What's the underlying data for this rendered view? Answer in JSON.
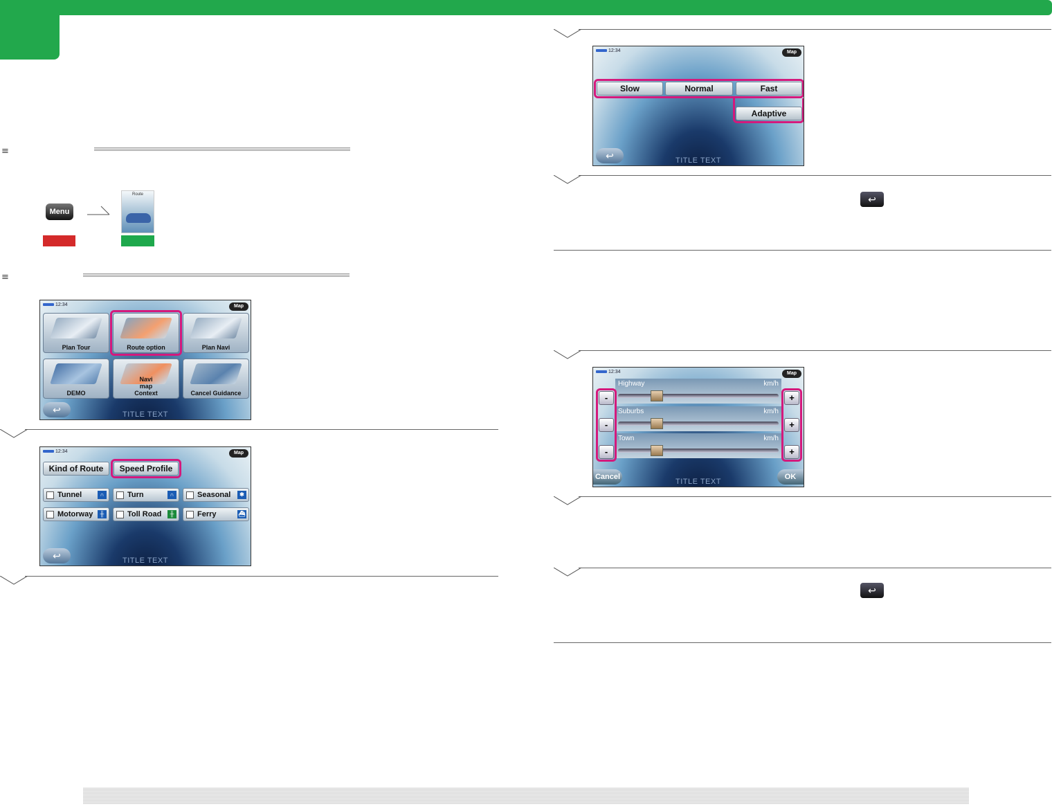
{
  "left": {
    "menu_button_label": "Menu",
    "route_thumb_label": "Route",
    "screen1": {
      "time": "12:34",
      "map_label": "Map",
      "title": "TITLE TEXT",
      "tiles": [
        "Plan Tour",
        "Route option",
        "Plan Navi",
        "DEMO",
        "Navi map Context",
        "Cancel Guidance"
      ]
    },
    "screen2": {
      "time": "12:34",
      "map_label": "Map",
      "title": "TITLE TEXT",
      "tabs": [
        "Kind of Route",
        "Speed Profile"
      ],
      "checks": [
        "Tunnel",
        "Turn",
        "Seasonal",
        "Motorway",
        "Toll Road",
        "Ferry"
      ]
    }
  },
  "right": {
    "screen3": {
      "time": "12:34",
      "map_label": "Map",
      "title": "TITLE TEXT",
      "profiles": [
        "Slow",
        "Normal",
        "Fast",
        "Adaptive"
      ]
    },
    "screen4": {
      "time": "12:34",
      "map_label": "Map",
      "title": "TITLE TEXT",
      "rows": [
        {
          "name": "Highway",
          "unit": "km/h",
          "level": 0.22
        },
        {
          "name": "Suburbs",
          "unit": "km/h",
          "level": 0.22
        },
        {
          "name": "Town",
          "unit": "km/h",
          "level": 0.22
        }
      ],
      "minus": "-",
      "plus": "+",
      "cancel": "Cancel",
      "ok": "OK"
    }
  }
}
